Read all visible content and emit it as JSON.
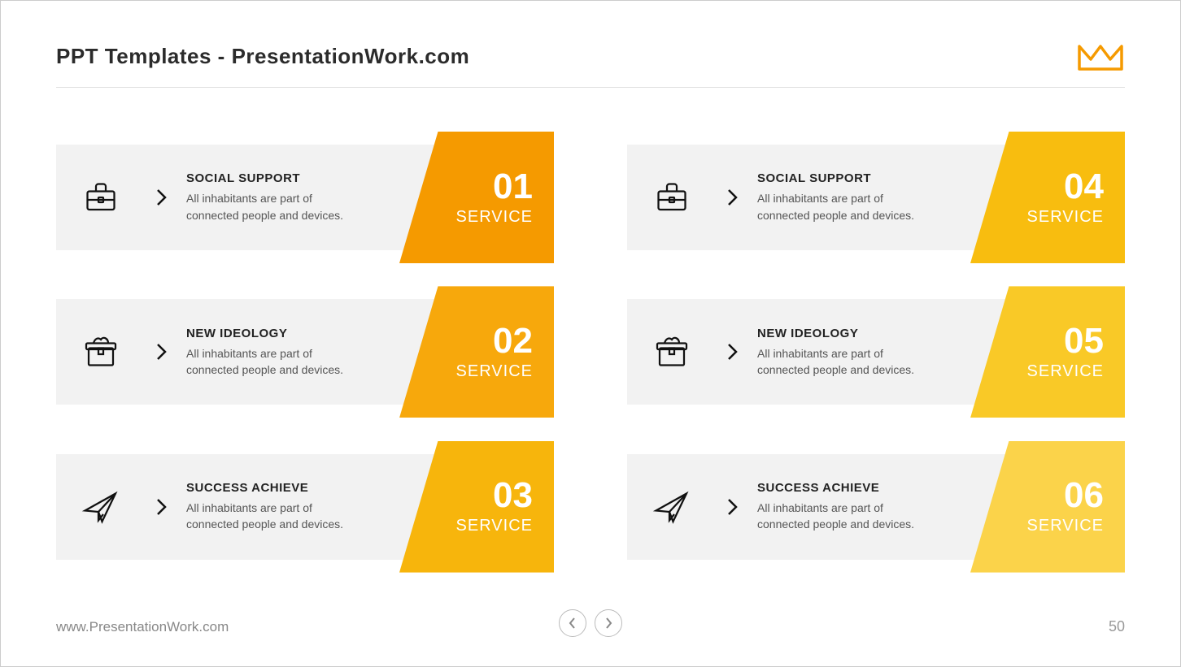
{
  "title": "PPT Templates - PresentationWork.com",
  "footer": {
    "website": "www.PresentationWork.com",
    "page": "50"
  },
  "service_label": "SERVICE",
  "cards": [
    {
      "num": "01",
      "heading": "SOCIAL SUPPORT",
      "desc": "All inhabitants are part of connected people and devices.",
      "icon": "briefcase",
      "color": "#f59a00"
    },
    {
      "num": "04",
      "heading": "SOCIAL SUPPORT",
      "desc": "All inhabitants are part of connected people and devices.",
      "icon": "briefcase",
      "color": "#f8bd0f"
    },
    {
      "num": "02",
      "heading": "NEW IDEOLOGY",
      "desc": "All inhabitants are part of connected people and devices.",
      "icon": "box",
      "color": "#f7a80c"
    },
    {
      "num": "05",
      "heading": "NEW IDEOLOGY",
      "desc": "All inhabitants are part of connected people and devices.",
      "icon": "box",
      "color": "#f9c927"
    },
    {
      "num": "03",
      "heading": "SUCCESS ACHIEVE",
      "desc": "All inhabitants are part of connected people and devices.",
      "icon": "paper-plane",
      "color": "#f7b50c"
    },
    {
      "num": "06",
      "heading": "SUCCESS ACHIEVE",
      "desc": "All inhabitants are part of connected people and devices.",
      "icon": "paper-plane",
      "color": "#fbd34a"
    }
  ]
}
